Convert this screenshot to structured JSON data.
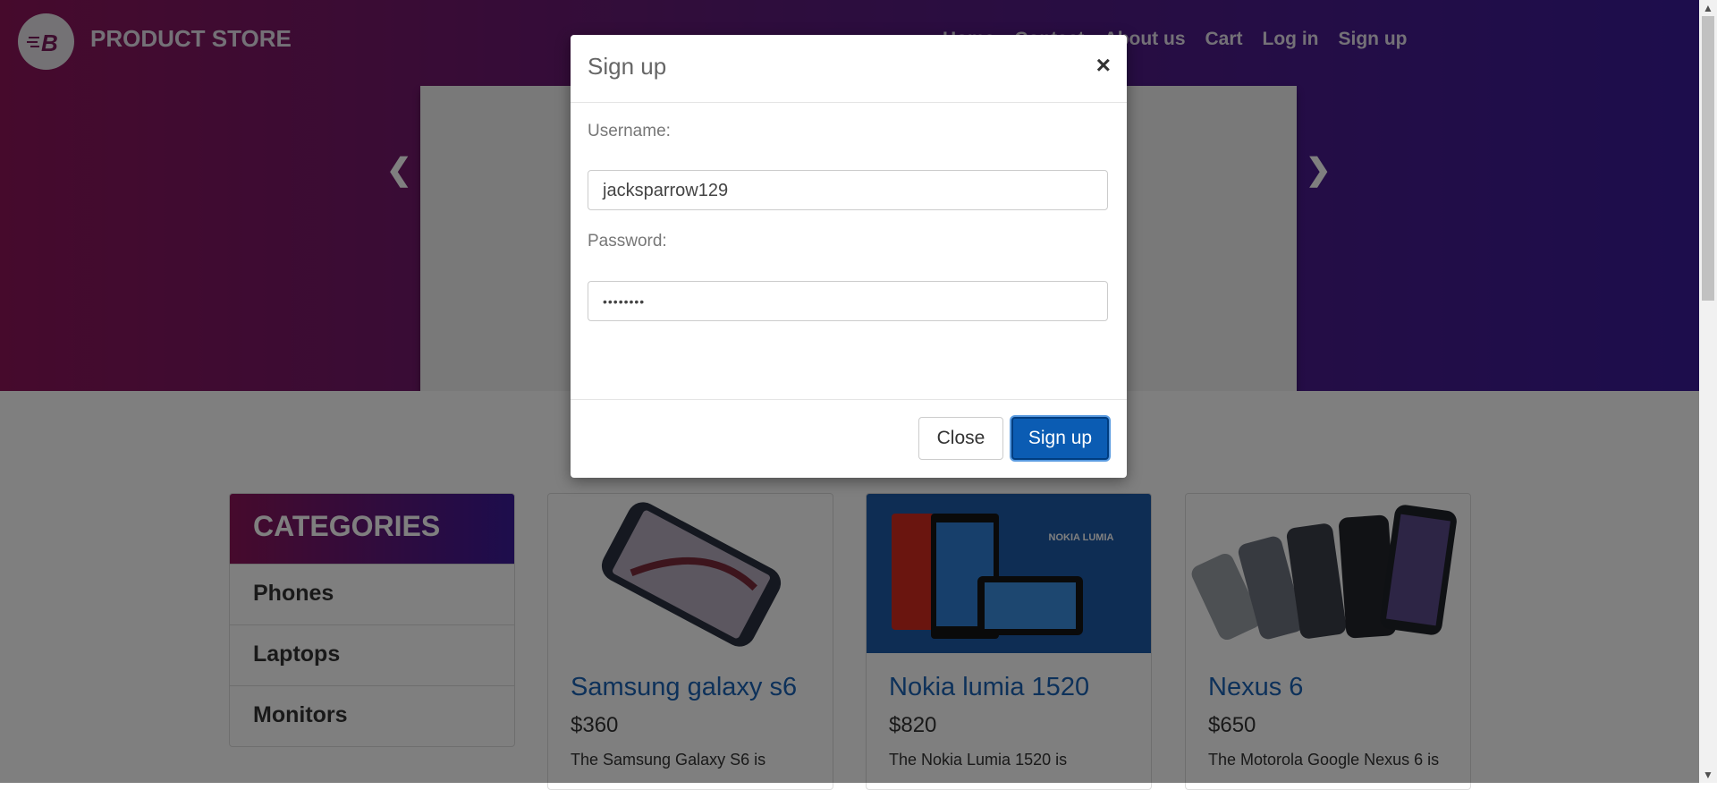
{
  "navbar": {
    "brand": "PRODUCT STORE",
    "logo_letter": "B",
    "items": [
      "Home",
      "Contact",
      "About us",
      "Cart",
      "Log in",
      "Sign up"
    ]
  },
  "categories": {
    "title": "CATEGORIES",
    "items": [
      "Phones",
      "Laptops",
      "Monitors"
    ]
  },
  "products": [
    {
      "name": "Samsung galaxy s6",
      "price": "$360",
      "desc": "The Samsung Galaxy S6 is"
    },
    {
      "name": "Nokia lumia 1520",
      "price": "$820",
      "desc": "The Nokia Lumia 1520 is",
      "banner": "NOKIA LUMIA"
    },
    {
      "name": "Nexus 6",
      "price": "$650",
      "desc": "The Motorola Google Nexus 6 is"
    }
  ],
  "modal": {
    "title": "Sign up",
    "close_symbol": "×",
    "username_label": "Username:",
    "username_value": "jacksparrow129",
    "password_label": "Password:",
    "password_value": "••••••••",
    "close_button": "Close",
    "signup_button": "Sign up"
  },
  "colors": {
    "hero_left": "#8c1559",
    "hero_right": "#3a1a99",
    "link_blue": "#1a62b5",
    "primary_button": "#0b5cb3"
  }
}
